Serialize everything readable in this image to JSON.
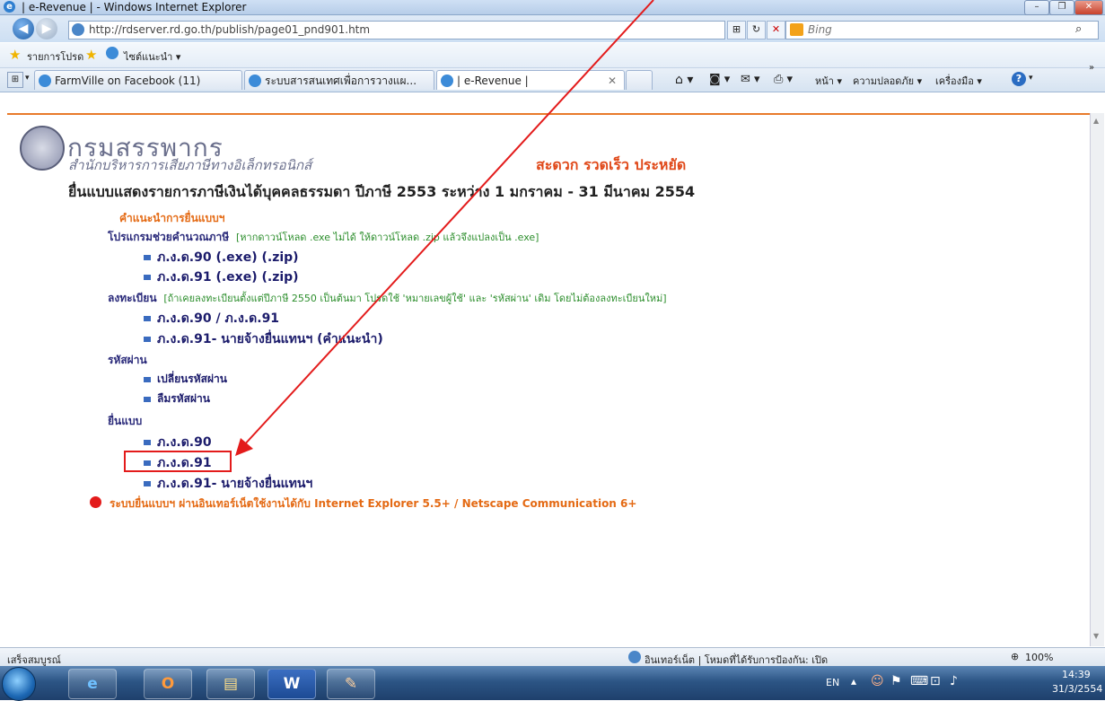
{
  "window": {
    "title": "| e-Revenue | - Windows Internet Explorer",
    "controls": [
      "–",
      "❐",
      "✕"
    ]
  },
  "address_bar": {
    "url": "http://rdserver.rd.go.th/publish/page01_pnd901.htm"
  },
  "search": {
    "placeholder": "Bing"
  },
  "favorites_bar": {
    "favorites_label": "รายการโปรด",
    "suggested_sites_label": "ไซต์แนะนำ ▾"
  },
  "tabs": [
    {
      "label": "FarmVille on Facebook (11)"
    },
    {
      "label": "ระบบสารสนเทศเพื่อการวางแผ..."
    },
    {
      "label": "| e-Revenue |"
    }
  ],
  "command_bar": {
    "page": "หน้า ▾",
    "safety": "ความปลอดภัย ▾",
    "tools": "เครื่องมือ ▾"
  },
  "page": {
    "dept_name": "กรมสรรพากร",
    "dept_sub": "สำนักบริหารการเสียภาษีทางอิเล็กทรอนิกส์",
    "slogan": "สะดวก   รวดเร็ว   ประหยัด",
    "heading": "ยื่นแบบแสดงรายการภาษีเงินได้บุคคลธรรมดา ปีภาษี 2553 ระหว่าง 1 มกราคม - 31 มีนาคม 2554",
    "instructions": "คำแนะนำการยื่นแบบฯ",
    "calc_program": "โปรแกรมช่วยคำนวณภาษี",
    "calc_note": "[หากดาวน์โหลด .exe ไม่ได้ ให้ดาวน์โหลด .zip แล้วจึงแปลงเป็น .exe]",
    "downloads": [
      {
        "form": "ภ.ง.ด.90",
        "exe": "(.exe)",
        "zip": "(.zip)"
      },
      {
        "form": "ภ.ง.ด.91",
        "exe": "(.exe)",
        "zip": "(.zip)"
      }
    ],
    "register_label": "ลงทะเบียน",
    "register_note": "[ถ้าเคยลงทะเบียนตั้งแต่ปีภาษี 2550 เป็นต้นมา โปรดใช้ 'หมายเลขผู้ใช้' และ 'รหัสผ่าน' เดิม โดยไม่ต้องลงทะเบียนใหม่]",
    "register_items": [
      "ภ.ง.ด.90 / ภ.ง.ด.91",
      "ภ.ง.ด.91- นายจ้างยื่นแทนฯ (คำแนะนำ)"
    ],
    "password_label": "รหัสผ่าน",
    "password_items": [
      "เปลี่ยนรหัสผ่าน",
      "ลืมรหัสผ่าน"
    ],
    "file_label": "ยื่นแบบ",
    "file_items": [
      "ภ.ง.ด.90",
      "ภ.ง.ด.91",
      "ภ.ง.ด.91- นายจ้างยื่นแทนฯ"
    ],
    "compat_note": "ระบบยื่นแบบฯ ผ่านอินเทอร์เน็ตใช้งานได้กับ Internet Explorer 5.5+ / Netscape Communication 6+"
  },
  "status_bar": {
    "left": "เสร็จสมบูรณ์",
    "zone": "อินเทอร์เน็ต | โหมดที่ได้รับการป้องกัน: เปิด",
    "zoom": "100%"
  },
  "taskbar": {
    "language": "EN",
    "time": "14:39",
    "date": "31/3/2554"
  },
  "colors": {
    "accent_orange": "#e46a14",
    "highlight_red": "#e31b1b",
    "link_navy": "#1b1b6b"
  }
}
